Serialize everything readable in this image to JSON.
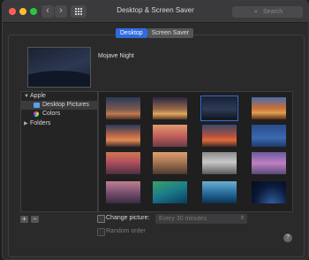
{
  "window": {
    "title": "Desktop & Screen Saver"
  },
  "search": {
    "placeholder": "Search"
  },
  "tabs": [
    {
      "label": "Desktop",
      "active": true
    },
    {
      "label": "Screen Saver",
      "active": false
    }
  ],
  "preview": {
    "name": "Mojave Night"
  },
  "sidebar": {
    "sections": [
      {
        "label": "Apple",
        "expanded": true,
        "items": [
          {
            "label": "Desktop Pictures",
            "selected": true,
            "icon": "folder-icon"
          },
          {
            "label": "Colors",
            "selected": false,
            "icon": "color-wheel-icon"
          }
        ]
      },
      {
        "label": "Folders",
        "expanded": false
      }
    ]
  },
  "thumbnails": [
    {
      "name": "thumb-1",
      "selected": false
    },
    {
      "name": "thumb-2",
      "selected": false
    },
    {
      "name": "mojave-night",
      "selected": true
    },
    {
      "name": "thumb-4",
      "selected": false
    },
    {
      "name": "thumb-5",
      "selected": false
    },
    {
      "name": "thumb-6",
      "selected": false
    },
    {
      "name": "thumb-7",
      "selected": false
    },
    {
      "name": "thumb-8",
      "selected": false
    },
    {
      "name": "thumb-9",
      "selected": false
    },
    {
      "name": "thumb-10",
      "selected": false
    },
    {
      "name": "thumb-11",
      "selected": false
    },
    {
      "name": "thumb-12",
      "selected": false
    },
    {
      "name": "thumb-13",
      "selected": false
    },
    {
      "name": "thumb-14",
      "selected": false
    },
    {
      "name": "thumb-15",
      "selected": false
    },
    {
      "name": "thumb-16",
      "selected": false
    }
  ],
  "controls": {
    "add_label": "+",
    "remove_label": "−",
    "change_picture_label": "Change picture:",
    "change_picture_checked": false,
    "interval_value": "Every 30 minutes",
    "random_order_label": "Random order",
    "random_order_checked": false,
    "help_label": "?"
  },
  "colors": {
    "accent": "#2f6be0"
  }
}
